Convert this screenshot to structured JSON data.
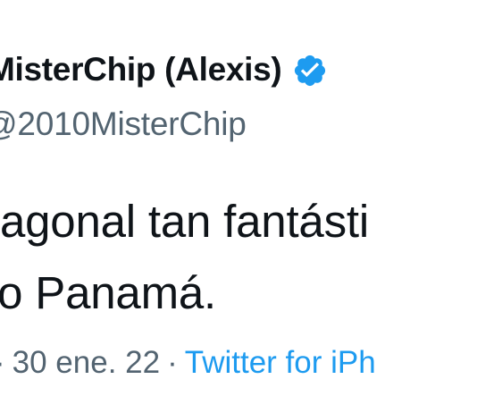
{
  "tweet": {
    "display_name": "MisterChip (Alexis)",
    "verified_icon": "verified-badge-icon",
    "handle": "@2010MisterChip",
    "text_lines": [
      "tagonal tan fantásti",
      "lo Panamá."
    ],
    "date_prefix": "·",
    "date": "30 ene. 22",
    "separator": "·",
    "source": "Twitter for iPh"
  },
  "colors": {
    "text": "#0f1419",
    "secondary": "#536471",
    "link": "#1d9bf0",
    "verified": "#1d9bf0"
  }
}
